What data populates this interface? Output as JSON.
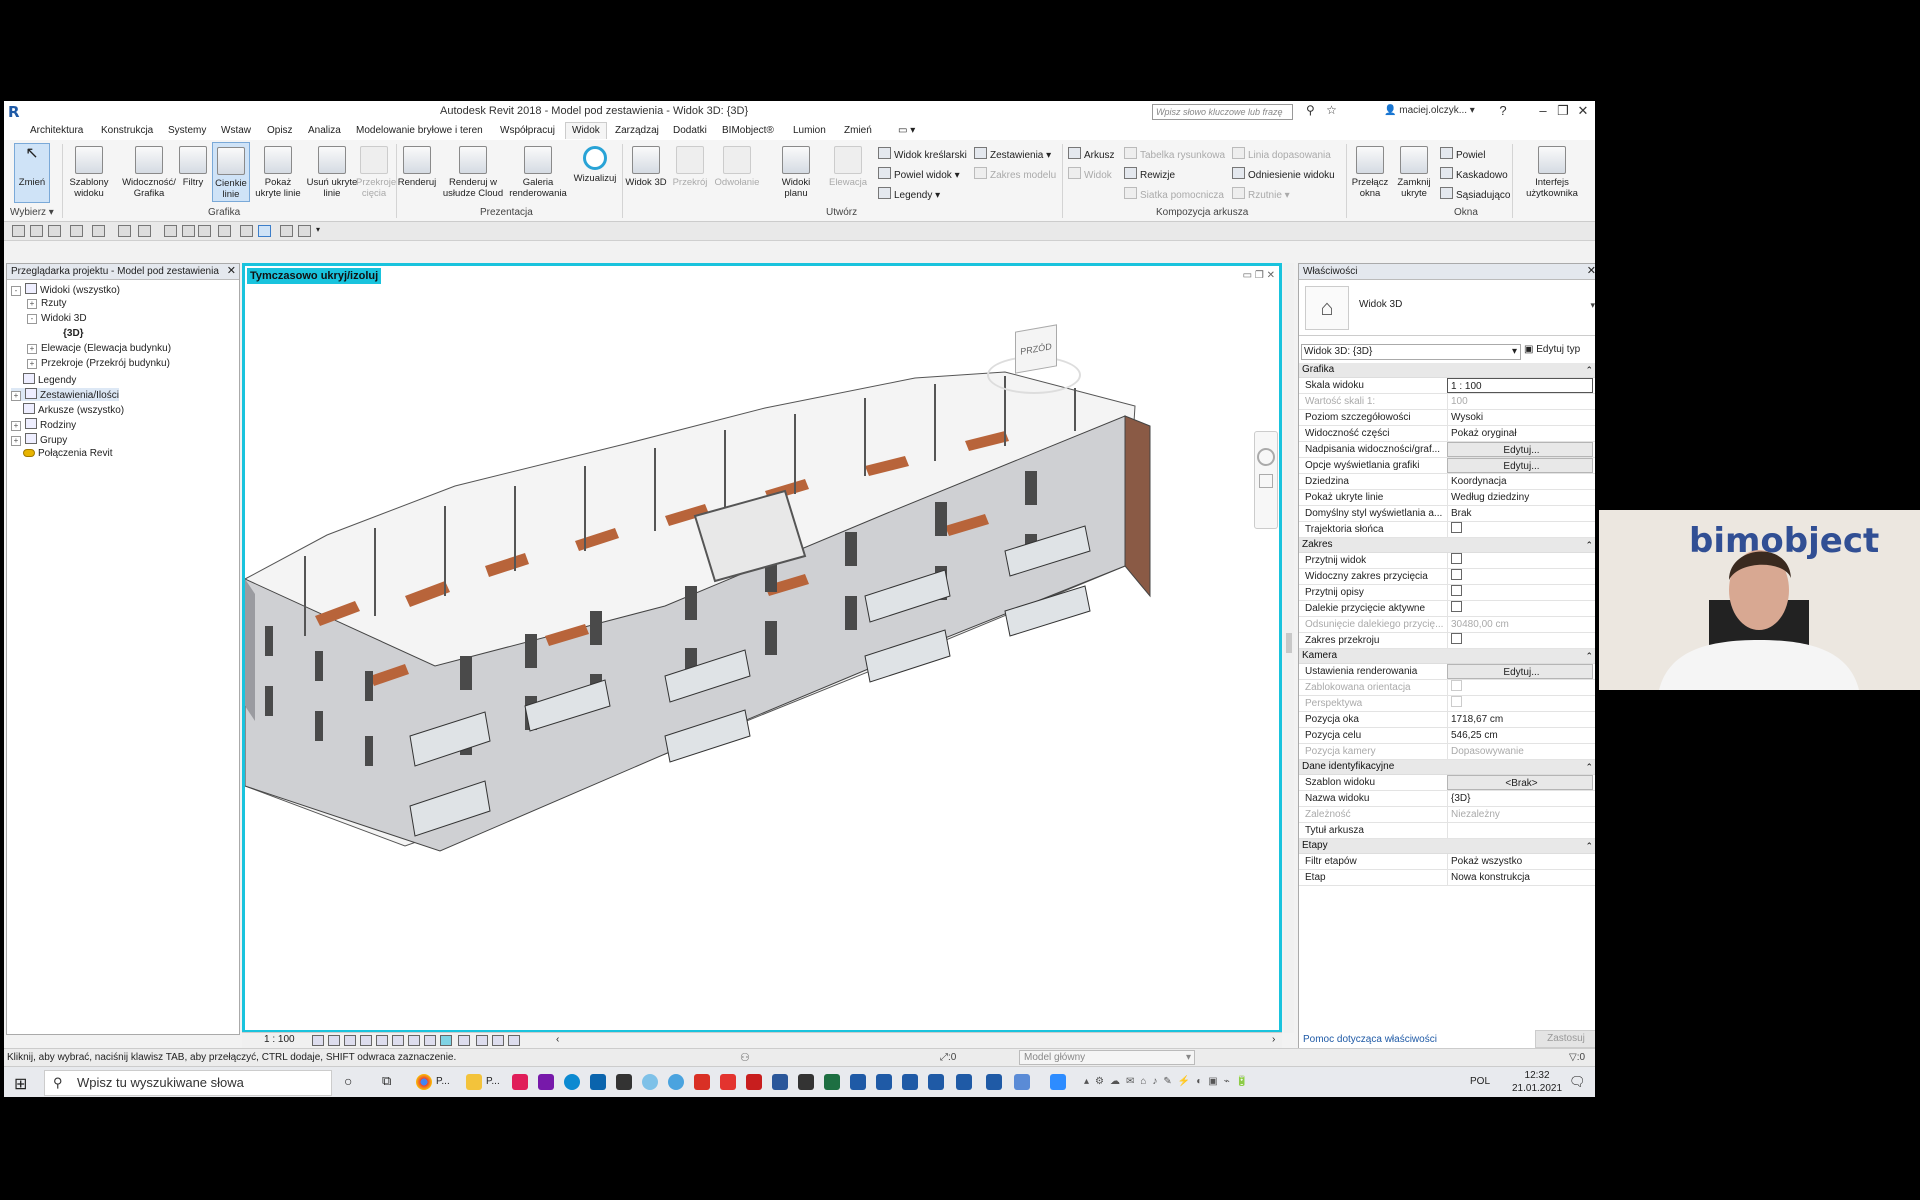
{
  "window": {
    "title": "Autodesk Revit 2018 -   Model pod zestawienia - Widok 3D: {3D}",
    "search_placeholder": "Wpisz słowo kluczowe lub frazę",
    "user": "maciej.olczyk..."
  },
  "tabs": [
    "Architektura",
    "Konstrukcja",
    "Systemy",
    "Wstaw",
    "Opisz",
    "Analiza",
    "Modelowanie bryłowe i teren",
    "Współpracuj",
    "Widok",
    "Zarządzaj",
    "Dodatki",
    "BIMobject®",
    "Lumion",
    "Zmień"
  ],
  "active_tab": "Widok",
  "ribbon": {
    "select": {
      "modify": "Zmień",
      "group": "Wybierz"
    },
    "grafika": {
      "buttons": [
        "Szablony widoku",
        "Widoczność/ Grafika",
        "Filtry",
        "Cienkie linie",
        "Pokaż ukryte linie",
        "Usuń ukryte linie",
        "Przekroje cięcia"
      ],
      "group": "Grafika"
    },
    "prezentacja": {
      "buttons": [
        "Renderuj",
        "Renderuj w usłudze Cloud",
        "Galeria renderowania",
        "Wizualizuj"
      ],
      "group": "Prezentacja"
    },
    "utworz": {
      "buttons": [
        "Widok 3D",
        "Przekrój",
        "Odwołanie",
        "Widoki planu",
        "Elewacja"
      ],
      "small": [
        "Widok kreślarski",
        "Powiel widok",
        "Legendy",
        "Zestawienia",
        "Zakres modelu"
      ],
      "group": "Utwórz"
    },
    "kompozycja": {
      "small": [
        "Arkusz",
        "Widok",
        "Tabelka rysunkowa",
        "Rewizje",
        "Siatka pomocnicza",
        "Linia dopasowania",
        "Odniesienie widoku",
        "Rzutnie"
      ],
      "group": "Kompozycja arkusza"
    },
    "okna": {
      "buttons": [
        "Przełącz okna",
        "Zamknij ukryte"
      ],
      "small": [
        "Powiel",
        "Kaskadowo",
        "Sąsiadująco"
      ],
      "group": "Okna"
    },
    "interfejs": {
      "button": "Interfejs użytkownika"
    }
  },
  "project_browser": {
    "title": "Przeglądarka projektu - Model pod zestawienia",
    "items": [
      {
        "label": "Widoki (wszystko)",
        "toggle": "-"
      },
      {
        "label": "Rzuty",
        "toggle": "+"
      },
      {
        "label": "Widoki 3D",
        "toggle": "-"
      },
      {
        "label": "{3D}",
        "toggle": ""
      },
      {
        "label": "Elewacje (Elewacja budynku)",
        "toggle": "+"
      },
      {
        "label": "Przekroje (Przekrój budynku)",
        "toggle": "+"
      },
      {
        "label": "Legendy",
        "toggle": ""
      },
      {
        "label": "Zestawienia/Ilości",
        "toggle": "+"
      },
      {
        "label": "Arkusze (wszystko)",
        "toggle": ""
      },
      {
        "label": "Rodziny",
        "toggle": "+"
      },
      {
        "label": "Grupy",
        "toggle": "+"
      },
      {
        "label": "Połączenia Revit",
        "toggle": ""
      }
    ]
  },
  "view": {
    "label": "Tymczasowo ukryj/izoluj",
    "scale": "1 : 100",
    "viewcube_face": "PRZÓD"
  },
  "properties": {
    "title": "Właściwości",
    "type_name": "Widok 3D",
    "selector": "Widok 3D: {3D}",
    "edit_type": "Edytuj typ",
    "sections": [
      {
        "name": "Grafika",
        "rows": [
          {
            "k": "Skala widoku",
            "v": "1 : 100",
            "kind": "input"
          },
          {
            "k": "Wartość skali   1:",
            "v": "100",
            "kind": "dis"
          },
          {
            "k": "Poziom szczegółowości",
            "v": "Wysoki"
          },
          {
            "k": "Widoczność części",
            "v": "Pokaż oryginał"
          },
          {
            "k": "Nadpisania widoczności/graf...",
            "v": "Edytuj...",
            "kind": "btn"
          },
          {
            "k": "Opcje wyświetlania grafiki",
            "v": "Edytuj...",
            "kind": "btn"
          },
          {
            "k": "Dziedzina",
            "v": "Koordynacja"
          },
          {
            "k": "Pokaż ukryte linie",
            "v": "Według dziedziny"
          },
          {
            "k": "Domyślny styl wyświetlania a...",
            "v": "Brak"
          },
          {
            "k": "Trajektoria słońca",
            "v": "",
            "kind": "cb"
          }
        ]
      },
      {
        "name": "Zakres",
        "rows": [
          {
            "k": "Przytnij widok",
            "v": "",
            "kind": "cb"
          },
          {
            "k": "Widoczny zakres przycięcia",
            "v": "",
            "kind": "cb"
          },
          {
            "k": "Przytnij opisy",
            "v": "",
            "kind": "cb"
          },
          {
            "k": "Dalekie przycięcie aktywne",
            "v": "",
            "kind": "cb"
          },
          {
            "k": "Odsunięcie dalekiego przycię...",
            "v": "30480,00 cm",
            "kind": "dis"
          },
          {
            "k": "Zakres przekroju",
            "v": "",
            "kind": "cb"
          }
        ]
      },
      {
        "name": "Kamera",
        "rows": [
          {
            "k": "Ustawienia renderowania",
            "v": "Edytuj...",
            "kind": "btn"
          },
          {
            "k": "Zablokowana orientacja",
            "v": "",
            "kind": "cbdis"
          },
          {
            "k": "Perspektywa",
            "v": "",
            "kind": "cbdis"
          },
          {
            "k": "Pozycja oka",
            "v": "1718,67 cm"
          },
          {
            "k": "Pozycja celu",
            "v": "546,25 cm"
          },
          {
            "k": "Pozycja kamery",
            "v": "Dopasowywanie",
            "kind": "dis"
          }
        ]
      },
      {
        "name": "Dane identyfikacyjne",
        "rows": [
          {
            "k": "Szablon widoku",
            "v": "<Brak>",
            "kind": "btn"
          },
          {
            "k": "Nazwa widoku",
            "v": "{3D}"
          },
          {
            "k": "Zależność",
            "v": "Niezależny",
            "kind": "dis"
          },
          {
            "k": "Tytuł arkusza",
            "v": ""
          }
        ]
      },
      {
        "name": "Etapy",
        "rows": [
          {
            "k": "Filtr etapów",
            "v": "Pokaż wszystko"
          },
          {
            "k": "Etap",
            "v": "Nowa konstrukcja"
          }
        ]
      }
    ],
    "help_link": "Pomoc dotycząca właściwości",
    "apply": "Zastosuj"
  },
  "statusbar": {
    "hint": "Kliknij, aby wybrać, naciśnij klawisz TAB, aby przełączyć, CTRL dodaje, SHIFT odwraca zaznaczenie.",
    "count": ":0",
    "model": "Model główny",
    "filter_count": ":0"
  },
  "taskbar": {
    "search": "Wpisz tu wyszukiwane słowa",
    "app_labels": [
      "P...",
      "P..."
    ],
    "lang": "POL",
    "time": "12:32",
    "date": "21.01.2021"
  },
  "webcam": {
    "banner": "bimobject"
  },
  "colors": {
    "view_border": "#19c3dd",
    "accent": "#1f5aa6",
    "wall": "#c9c9cc",
    "floor": "#b8643a"
  }
}
